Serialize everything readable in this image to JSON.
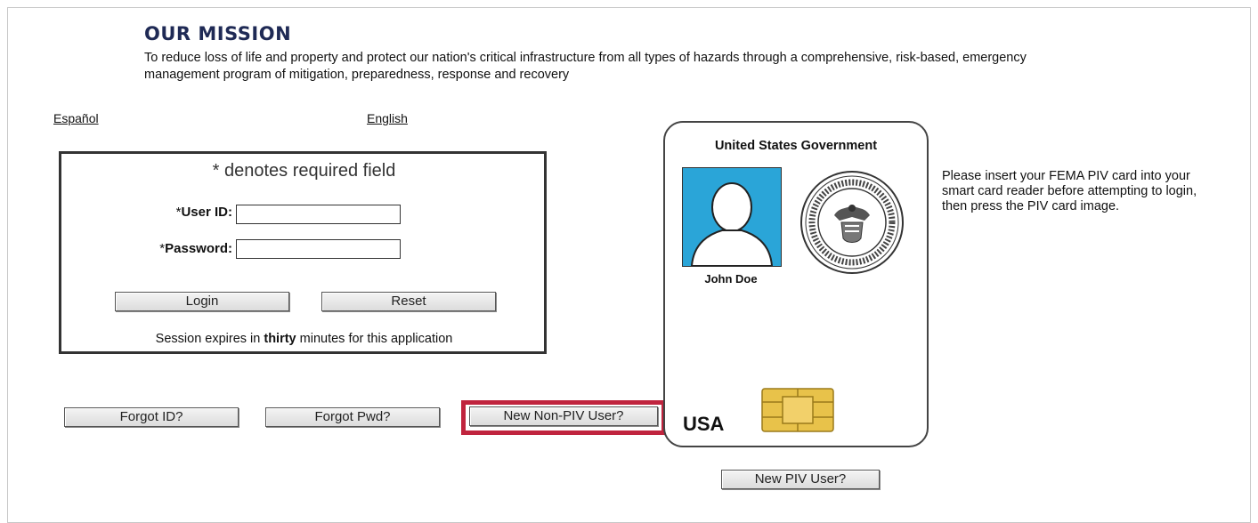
{
  "mission": {
    "title": "OUR MISSION",
    "text": "To reduce loss of life and property and protect our nation's critical infrastructure from all types of hazards through a comprehensive, risk-based, emergency management program of mitigation, preparedness, response and recovery"
  },
  "language": {
    "spanish": "Español",
    "english": "English"
  },
  "login": {
    "required_note": "* denotes required field",
    "user_id_label": "User ID:",
    "password_label": "Password:",
    "required_star": "*",
    "user_id_value": "",
    "password_value": "",
    "login_button": "Login",
    "reset_button": "Reset",
    "session_note_prefix": "Session expires in ",
    "session_note_bold": "thirty",
    "session_note_suffix": " minutes for this application"
  },
  "actions": {
    "forgot_id": "Forgot ID?",
    "forgot_pwd": "Forgot Pwd?",
    "new_non_piv": "New Non-PIV User?",
    "new_piv": "New PIV User?"
  },
  "piv_card": {
    "header": "United States Government",
    "name": "John Doe",
    "country": "USA",
    "photo_color": "#2aa5d8",
    "chip_color": "#e8c24a"
  },
  "instructions": "Please insert your FEMA PIV card into your smart card reader before attempting to login, then press the PIV card image.",
  "colors": {
    "mission_title": "#1f2a55",
    "highlight": "#c0243e"
  }
}
